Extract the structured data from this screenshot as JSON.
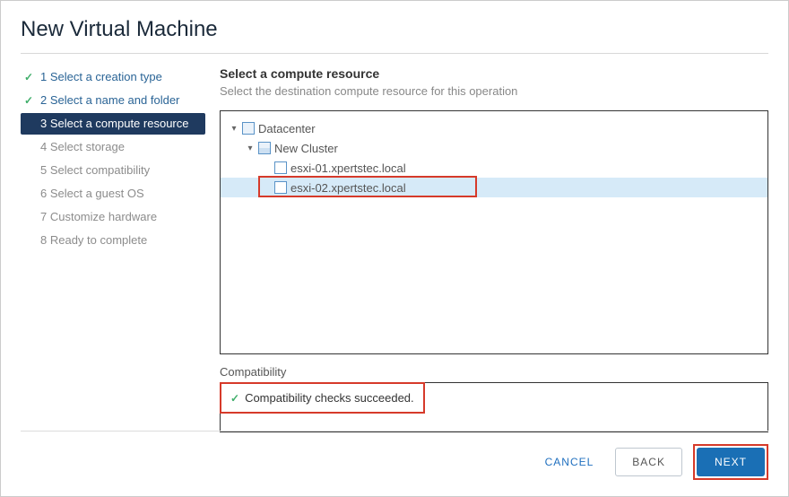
{
  "title": "New Virtual Machine",
  "steps": [
    {
      "label": "1 Select a creation type",
      "state": "done"
    },
    {
      "label": "2 Select a name and folder",
      "state": "done"
    },
    {
      "label": "3 Select a compute resource",
      "state": "active"
    },
    {
      "label": "4 Select storage",
      "state": "pending"
    },
    {
      "label": "5 Select compatibility",
      "state": "pending"
    },
    {
      "label": "6 Select a guest OS",
      "state": "pending"
    },
    {
      "label": "7 Customize hardware",
      "state": "pending"
    },
    {
      "label": "8 Ready to complete",
      "state": "pending"
    }
  ],
  "panel": {
    "title": "Select a compute resource",
    "subtitle": "Select the destination compute resource for this operation"
  },
  "tree": {
    "datacenter": "Datacenter",
    "cluster": "New Cluster",
    "host1": "esxi-01.xpertstec.local",
    "host2": "esxi-02.xpertstec.local"
  },
  "compat": {
    "label": "Compatibility",
    "message": "Compatibility checks succeeded."
  },
  "buttons": {
    "cancel": "CANCEL",
    "back": "BACK",
    "next": "NEXT"
  }
}
